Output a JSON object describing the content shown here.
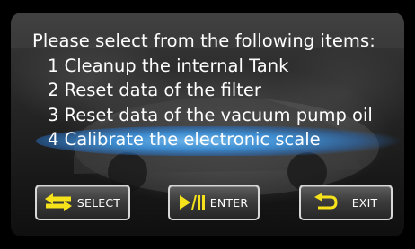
{
  "prompt": {
    "title": "Please select from the following items:"
  },
  "menu": {
    "items": [
      {
        "label": "1 Cleanup the internal Tank"
      },
      {
        "label": "2 Reset data of the filter"
      },
      {
        "label": "3 Reset data of the vacuum pump oil"
      },
      {
        "label": "4 Calibrate the electronic scale"
      }
    ],
    "selected_index": 3
  },
  "buttons": {
    "select": {
      "label": "SELECT",
      "icon": "swap-arrows-icon"
    },
    "enter": {
      "label": "ENTER",
      "icon": "play-pause-icon"
    },
    "exit": {
      "label": "EXIT",
      "icon": "return-arrow-icon"
    }
  },
  "colors": {
    "icon_yellow": "#f5e21b",
    "highlight_blue": "#4d9ad8",
    "text": "#ffffff"
  }
}
